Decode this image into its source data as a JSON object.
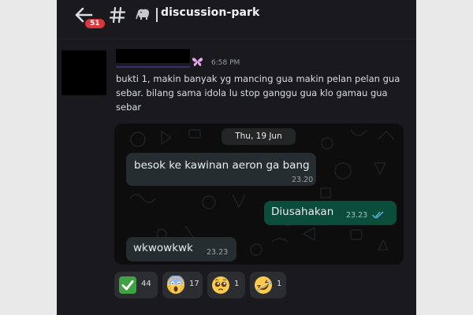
{
  "header": {
    "unread_count": "51",
    "channel_name": "discussion-park"
  },
  "message": {
    "timestamp": "6:58 PM",
    "text": "bukti 1, makin banyak yg mancing gua makin pelan pelan gua sebar. bilang sama idola lu stop ganggu gua klo gamau gua sebar"
  },
  "attachment": {
    "date_chip": "Thu, 19 Jun",
    "messages": [
      {
        "direction": "incoming",
        "text": "besok ke kawinan aeron ga bang",
        "time": "23.20"
      },
      {
        "direction": "outgoing",
        "text": "Diusahakan",
        "time": "23.23",
        "read_ticks": true
      },
      {
        "direction": "incoming",
        "text": "wkwowkwk",
        "time": "23.23"
      }
    ]
  },
  "reactions": [
    {
      "emoji": "check-mark-emoji",
      "count": "44"
    },
    {
      "emoji": "screaming-face-emoji",
      "count": "17"
    },
    {
      "emoji": "pleading-face-emoji",
      "count": "1"
    },
    {
      "emoji": "rolling-laughing-emoji",
      "count": "1"
    }
  ],
  "colors": {
    "background": "#1a1a1e",
    "unread_badge": "#da373c",
    "reaction_bg": "#2b2d31",
    "whatsapp_incoming": "#262d31",
    "whatsapp_outgoing": "#0b4d3b",
    "read_ticks": "#53bdeb"
  }
}
